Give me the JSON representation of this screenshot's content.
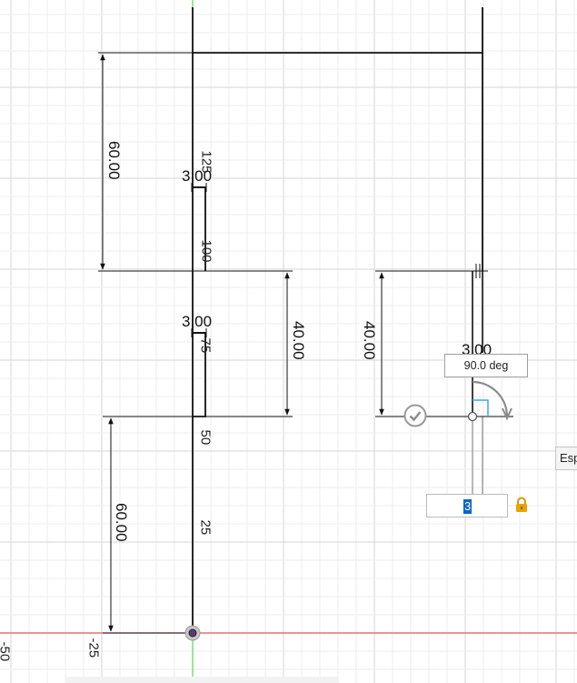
{
  "dimensions": {
    "left_top_height": "60.00",
    "left_bottom_height": "60.00",
    "middle_height": "40.00",
    "right_middle_height": "40.00",
    "upper_notch_width": "3.00",
    "lower_notch_width": "3.00",
    "right_slot_width": "3.00"
  },
  "ruler": {
    "vertical_ticks": [
      "125",
      "100",
      "75",
      "50",
      "25"
    ],
    "horizontal_ticks": [
      "-50",
      "-25"
    ]
  },
  "angle_box": {
    "value": "90.0 deg"
  },
  "value_input": {
    "selected_text": "3"
  },
  "side_panel": {
    "label": "Esp"
  },
  "icons": {
    "confirm": "check-circle-icon",
    "lock": "lock-icon"
  },
  "colors": {
    "grid_minor": "#ececec",
    "grid_major": "#d6d6d6",
    "y_axis": "#5cd65c",
    "x_axis": "#e05555",
    "sketch": "#111111",
    "selection": "#0b63c7",
    "lock": "#e8a400"
  }
}
